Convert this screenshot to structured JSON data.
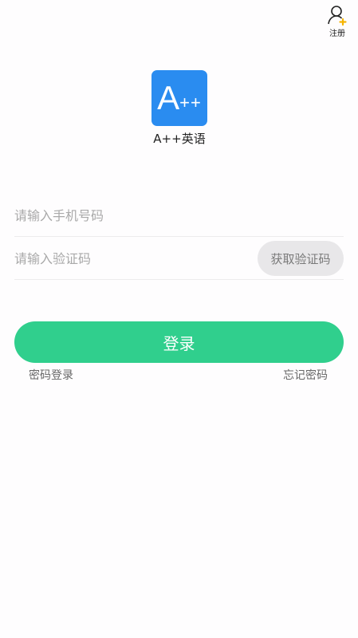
{
  "header": {
    "register_label": "注册",
    "register_icon": "user-add-icon"
  },
  "logo": {
    "main": "A",
    "suffix": "++",
    "color": "#2a8cf0"
  },
  "app_name": "A++英语",
  "form": {
    "phone_placeholder": "请输入手机号码",
    "code_placeholder": "请输入验证码",
    "get_code_label": "获取验证码",
    "login_label": "登录",
    "login_color": "#30cf8d"
  },
  "links": {
    "password_login": "密码登录",
    "forgot_password": "忘记密码"
  }
}
